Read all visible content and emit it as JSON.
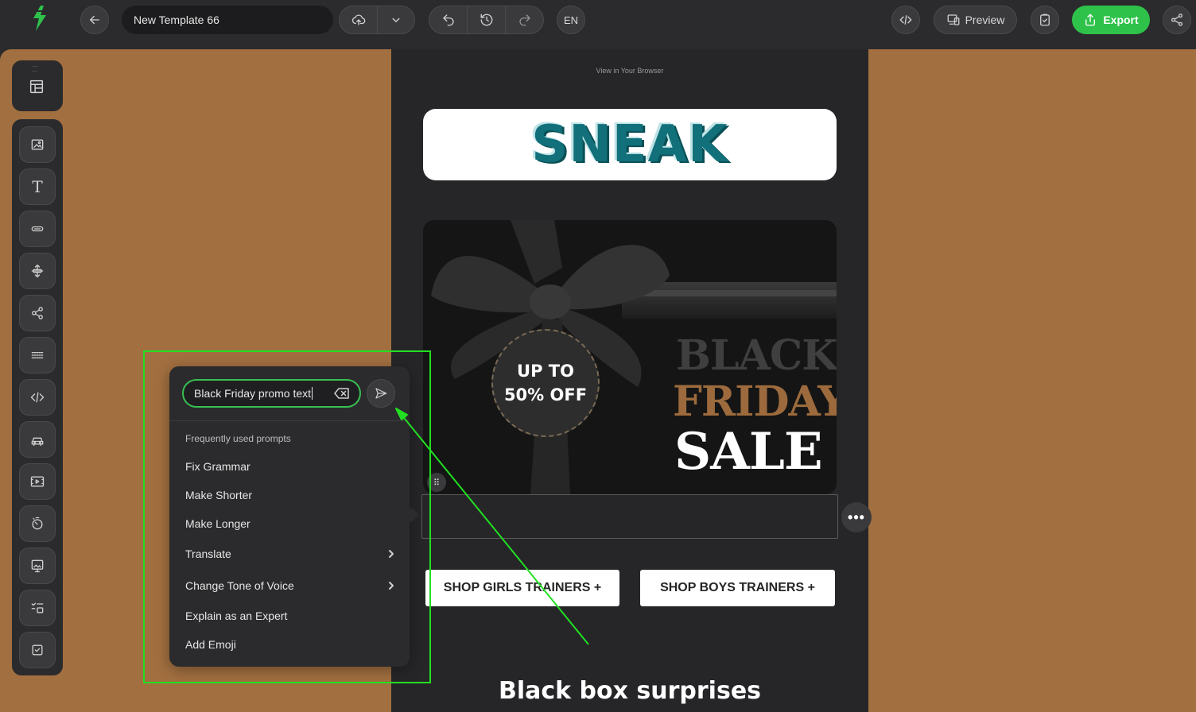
{
  "topbar": {
    "template_name": "New Template 66",
    "language": "EN",
    "preview_label": "Preview",
    "export_label": "Export"
  },
  "email": {
    "view_in_browser": "View in Your Browser",
    "logo_text": "SNEAK",
    "tag_line1": "UP TO",
    "tag_line2": "50% OFF",
    "banner_black": "BLACK",
    "banner_friday": "FRIDAY",
    "banner_sale": "SALE",
    "shop_girls": "SHOP GIRLS TRAINERS +",
    "shop_boys": "SHOP BOYS TRAINERS +",
    "heading": "Black box surprises"
  },
  "ai_popup": {
    "input_value": "Black Friday promo text",
    "prompts_header": "Frequently used prompts",
    "prompts": [
      {
        "label": "Fix Grammar"
      },
      {
        "label": "Make Shorter"
      },
      {
        "label": "Make Longer"
      },
      {
        "label": "Translate"
      },
      {
        "label": "Change Tone of Voice"
      },
      {
        "label": "Explain as an Expert"
      },
      {
        "label": "Add Emoji"
      }
    ]
  },
  "colors": {
    "accent_green": "#2fc24a",
    "canvas_background": "#a26f40",
    "annotation_green": "#22e022",
    "logo_teal": "#11707a"
  },
  "icons": {
    "logo": "brand-bolt-icon",
    "back": "arrow-left-icon",
    "save_cloud": "cloud-upload-icon",
    "dropdown": "chevron-down-icon",
    "undo": "undo-icon",
    "history": "history-icon",
    "redo": "redo-icon",
    "code": "code-icon",
    "preview": "devices-icon",
    "checklist": "clipboard-check-icon",
    "export": "share-upload-icon",
    "share": "share-icon"
  }
}
